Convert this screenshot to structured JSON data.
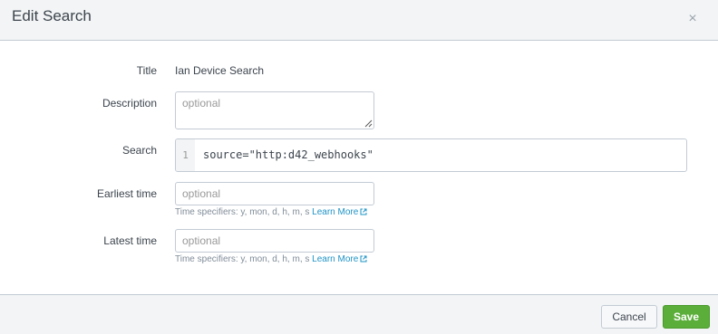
{
  "dialog": {
    "title": "Edit Search",
    "close_symbol": "×"
  },
  "form": {
    "title": {
      "label": "Title",
      "value": "Ian Device Search"
    },
    "description": {
      "label": "Description",
      "placeholder": "optional",
      "value": ""
    },
    "search": {
      "label": "Search",
      "line_number": "1",
      "query": "source=\"http:d42_webhooks\""
    },
    "earliest_time": {
      "label": "Earliest time",
      "placeholder": "optional",
      "help_text": "Time specifiers: y, mon, d, h, m, s",
      "help_link": "Learn More"
    },
    "latest_time": {
      "label": "Latest time",
      "placeholder": "optional",
      "help_text": "Time specifiers: y, mon, d, h, m, s",
      "help_link": "Learn More"
    }
  },
  "footer": {
    "cancel_label": "Cancel",
    "save_label": "Save"
  },
  "colors": {
    "save_button": "#5cae3b",
    "link": "#1e93c6",
    "header_bg": "#f2f4f5"
  },
  "icons": {
    "close": "close-icon",
    "external_link": "external-link-icon",
    "resize": "resize-grip-icon"
  }
}
